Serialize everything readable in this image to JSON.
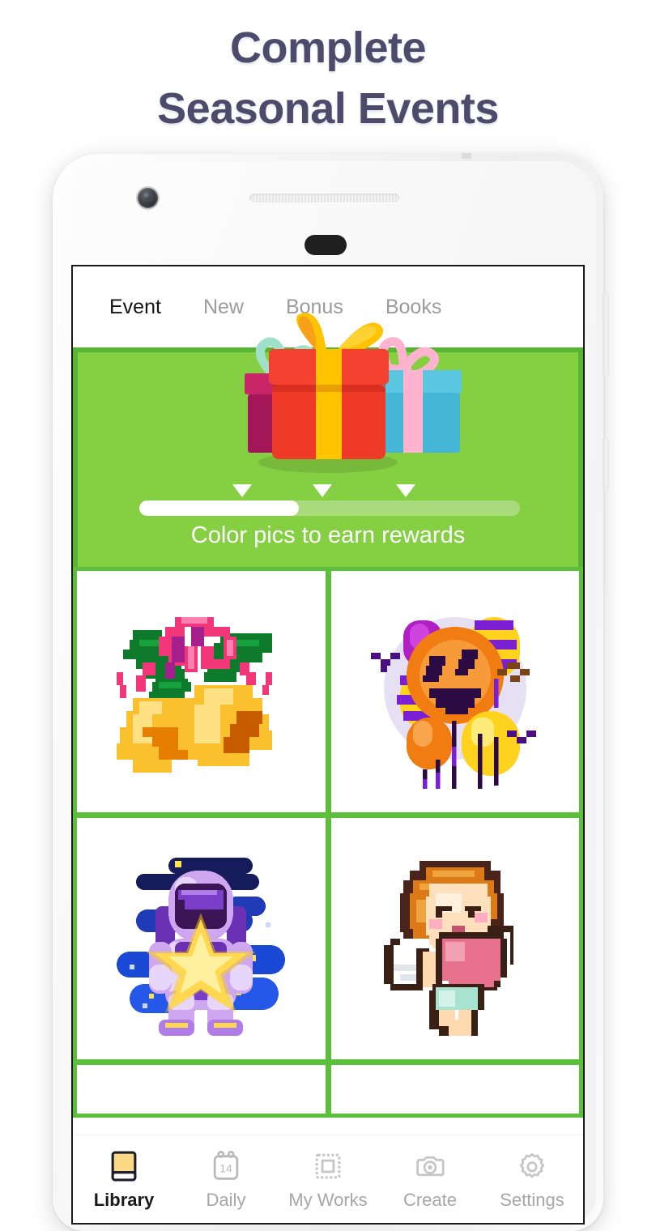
{
  "headline": {
    "line1": "Complete",
    "line2": "Seasonal Events",
    "color": "#4d4a6b"
  },
  "app": {
    "tabs": [
      {
        "label": "Event",
        "active": true
      },
      {
        "label": "New",
        "active": false
      },
      {
        "label": "Bonus",
        "active": false
      },
      {
        "label": "Books",
        "active": false
      }
    ],
    "banner": {
      "caption": "Color pics to earn rewards",
      "artwork": "three-gift-boxes",
      "background_color": "#84cf42",
      "border_color": "#56b533",
      "progress": {
        "percent": 42,
        "fill_color": "#ffffff",
        "track_color": "#a9db7d",
        "markers": [
          27,
          48,
          70
        ]
      }
    },
    "grid": {
      "gridline_color": "#5cbf3c",
      "tiles": [
        {
          "name": "christmas-bells",
          "label": "christmas-bells-pixel-art"
        },
        {
          "name": "halloween-balloons",
          "label": "halloween-balloons-pixel-art"
        },
        {
          "name": "astronaut-star",
          "label": "astronaut-with-star-pixel-art"
        },
        {
          "name": "cupid-heart",
          "label": "cupid-with-heart-pixel-art"
        },
        {
          "name": "tile-empty-left",
          "label": ""
        },
        {
          "name": "tile-empty-right",
          "label": ""
        }
      ]
    },
    "bottom_nav": [
      {
        "label": "Library",
        "icon": "book-icon",
        "active": true
      },
      {
        "label": "Daily",
        "icon": "calendar-icon",
        "badge": "14",
        "active": false
      },
      {
        "label": "My Works",
        "icon": "stamp-frame-icon",
        "active": false
      },
      {
        "label": "Create",
        "icon": "camera-icon",
        "active": false
      },
      {
        "label": "Settings",
        "icon": "gear-icon",
        "active": false
      }
    ]
  }
}
